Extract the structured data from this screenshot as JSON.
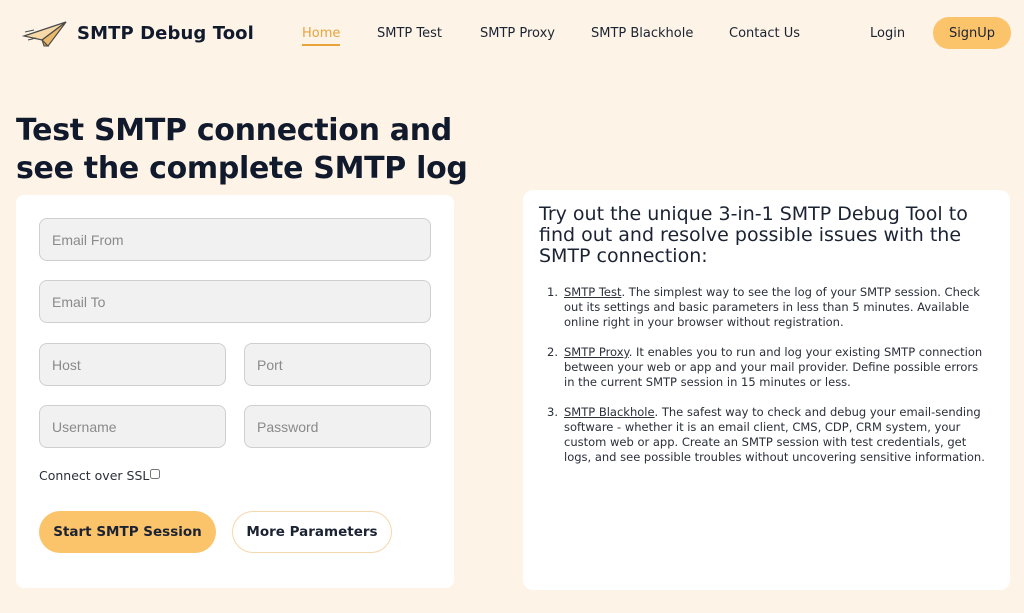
{
  "header": {
    "brand": "SMTP Debug Tool",
    "nav": [
      {
        "label": "Home",
        "active": true
      },
      {
        "label": "SMTP Test",
        "active": false
      },
      {
        "label": "SMTP Proxy",
        "active": false
      },
      {
        "label": "SMTP Blackhole",
        "active": false
      },
      {
        "label": "Contact Us",
        "active": false
      }
    ],
    "login_label": "Login",
    "signup_label": "SignUp",
    "logo_icon": "paper-plane-icon"
  },
  "hero": {
    "headline_line1": "Test SMTP connection and",
    "headline_line2": "see the complete SMTP log"
  },
  "form": {
    "email_from_placeholder": "Email From",
    "email_to_placeholder": "Email To",
    "host_placeholder": "Host",
    "port_placeholder": "Port",
    "username_placeholder": "Username",
    "password_placeholder": "Password",
    "ssl_label": "Connect over SSL",
    "ssl_checked": false,
    "start_label": "Start SMTP Session",
    "more_label": "More Parameters"
  },
  "info": {
    "title": "Try out the unique 3-in-1 SMTP Debug Tool to find out and resolve possible issues with the SMTP connection:",
    "items": [
      {
        "num": "1.",
        "link": "SMTP Test",
        "text": ". The simplest way to see the log of your SMTP session. Check out its settings and basic parameters in less than 5 minutes. Available online right in your browser without registration."
      },
      {
        "num": "2.",
        "link": "SMTP Proxy",
        "text": ". It enables you to run and log your existing SMTP connection between your web or app and your mail provider. Define possible errors in the current SMTP session in 15 minutes or less."
      },
      {
        "num": "3.",
        "link": "SMTP Blackhole",
        "text": ". The safest way to check and debug your email-sending software - whether it is an email client, CMS, CDP, CRM system, your custom web or app. Create an SMTP session with test credentials, get logs, and see possible troubles without uncovering sensitive information."
      }
    ]
  },
  "colors": {
    "background": "#fdf3e6",
    "accent": "#fbc36a",
    "active_nav": "#e8a33d",
    "text": "#1b2333"
  }
}
